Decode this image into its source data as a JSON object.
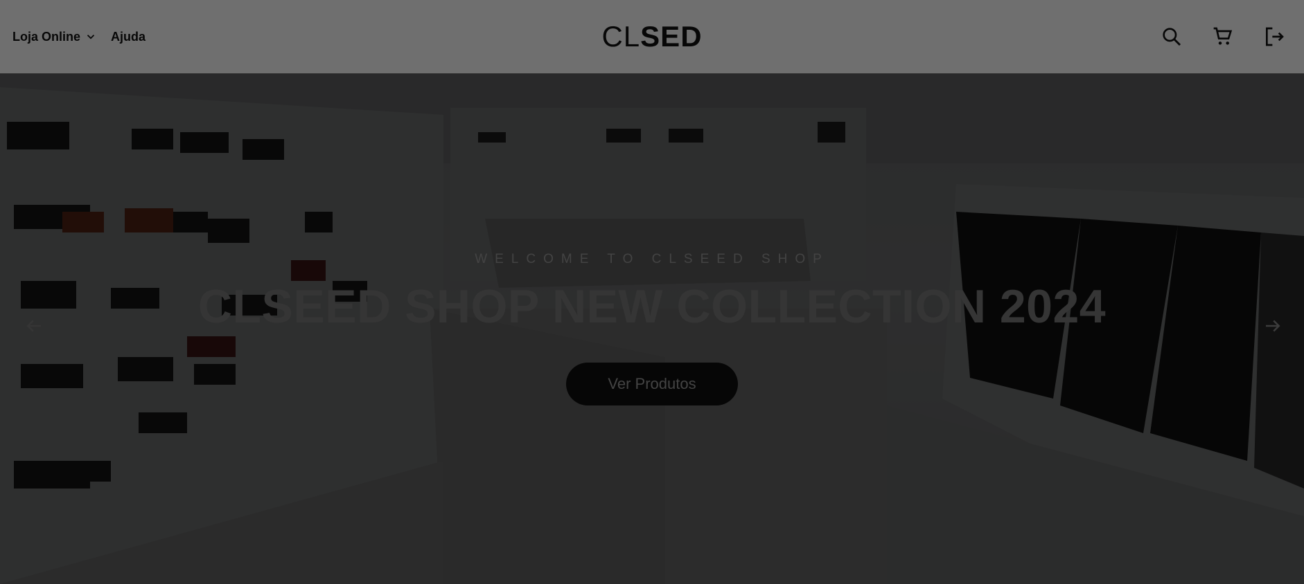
{
  "header": {
    "nav": [
      {
        "label": "Loja Online",
        "icon": "chevron-down-icon"
      },
      {
        "label": "Ajuda"
      }
    ],
    "logo": {
      "light": "CL",
      "bold": "SED"
    },
    "icons": [
      "search-icon",
      "cart-icon",
      "logout-icon"
    ]
  },
  "hero": {
    "eyebrow": "WELCOME TO CLSEED SHOP",
    "title": "CLSEED SHOP NEW COLLECTION 2024",
    "cta_label": "Ver Produtos",
    "prev_icon": "arrow-left-icon",
    "next_icon": "arrow-right-icon"
  },
  "colors": {
    "header_bg": "#fdfdfd",
    "cta_bg": "#0f0f0f",
    "overlay": "#000000"
  }
}
